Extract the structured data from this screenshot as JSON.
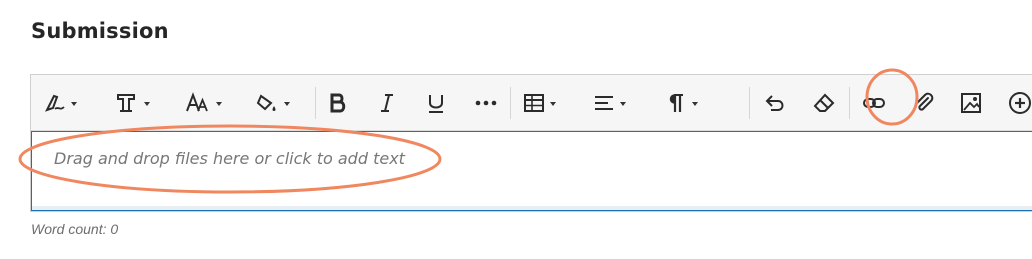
{
  "section_title": "Submission",
  "editor": {
    "placeholder": "Drag and drop files here or click to add text",
    "word_count_label": "Word count: 0"
  },
  "toolbar": {
    "buttons": [
      {
        "icon": "pen-style-icon",
        "dropdown": true
      },
      {
        "icon": "text-style-icon",
        "dropdown": true
      },
      {
        "icon": "font-size-icon",
        "dropdown": true
      },
      {
        "icon": "highlight-fill-icon",
        "dropdown": true
      },
      {
        "icon": "bold-icon",
        "dropdown": false
      },
      {
        "icon": "italic-icon",
        "dropdown": false
      },
      {
        "icon": "underline-icon",
        "dropdown": false
      },
      {
        "icon": "more-icon",
        "dropdown": false
      },
      {
        "icon": "table-icon",
        "dropdown": true
      },
      {
        "icon": "align-icon",
        "dropdown": true
      },
      {
        "icon": "paragraph-icon",
        "dropdown": true
      },
      {
        "icon": "undo-icon",
        "dropdown": false
      },
      {
        "icon": "eraser-icon",
        "dropdown": false
      },
      {
        "icon": "link-icon",
        "dropdown": false
      },
      {
        "icon": "attach-icon",
        "dropdown": false
      },
      {
        "icon": "image-icon",
        "dropdown": false
      },
      {
        "icon": "add-content-icon",
        "dropdown": true
      }
    ]
  },
  "colors": {
    "annotation": "#f0875f",
    "focus_border": "#1a73b8",
    "icon": "#2b2b2b"
  }
}
